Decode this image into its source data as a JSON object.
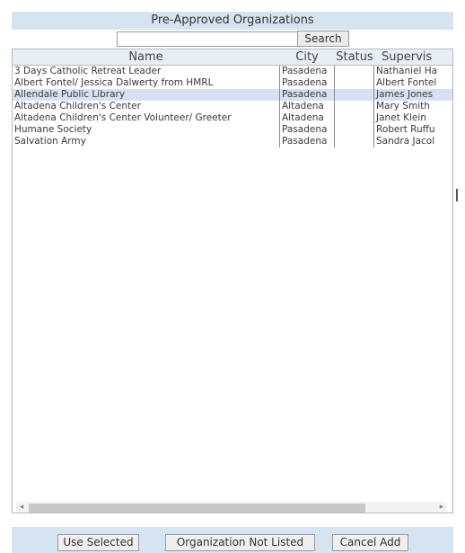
{
  "title": "Pre-Approved Organizations",
  "search": {
    "value": "",
    "placeholder": "",
    "button_label": "Search"
  },
  "columns": [
    "Name",
    "City",
    "Status",
    "Supervis"
  ],
  "rows": [
    {
      "name": "3 Days Catholic Retreat Leader",
      "city": "Pasadena",
      "status": "",
      "supervisor": "Nathaniel Ha"
    },
    {
      "name": "Albert Fontel/ Jessica Dalwerty from HMRL",
      "city": "Pasadena",
      "status": "",
      "supervisor": "Albert Fontel"
    },
    {
      "name": "Allendale Public Library",
      "city": "Pasadena",
      "status": "",
      "supervisor": "James Jones"
    },
    {
      "name": "Altadena Children's Center",
      "city": "Altadena",
      "status": "",
      "supervisor": "Mary Smith"
    },
    {
      "name": "Altadena Children's Center Volunteer/ Greeter",
      "city": "Altadena",
      "status": "",
      "supervisor": "Janet Klein"
    },
    {
      "name": "Humane Society",
      "city": "Pasadena",
      "status": "",
      "supervisor": "Robert Ruffu"
    },
    {
      "name": "Salvation Army",
      "city": "Pasadena",
      "status": "",
      "supervisor": "Sandra Jacol"
    }
  ],
  "selected_row": "Allendale Public Library",
  "scrollbar": {
    "left_arrow": "◂",
    "right_arrow": "▸"
  },
  "buttons": {
    "use_selected": "Use Selected",
    "not_listed": "Organization Not Listed",
    "cancel_add": "Cancel Add"
  },
  "colors": {
    "header_bg": "#d6e4f1",
    "selected_row": "#d6e2f2"
  }
}
